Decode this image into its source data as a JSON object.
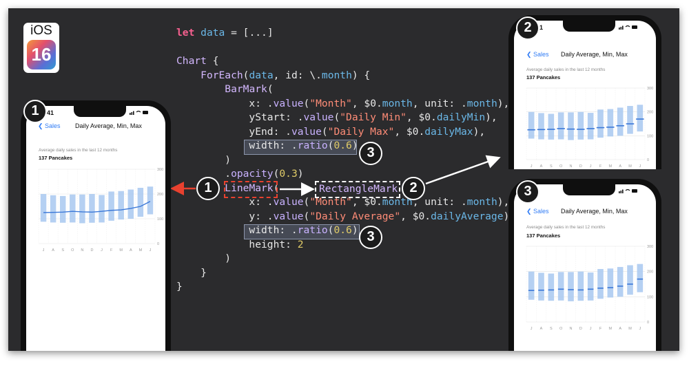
{
  "ios_badge": {
    "label": "iOS",
    "version": "16"
  },
  "code": {
    "lines": [
      [
        [
          "kw",
          "let "
        ],
        [
          "id",
          "data"
        ],
        [
          "pn",
          " = [...]"
        ]
      ],
      [],
      [
        [
          "tp",
          "Chart"
        ],
        [
          "pn",
          " {"
        ]
      ],
      [
        [
          "pn",
          "    "
        ],
        [
          "tp",
          "ForEach"
        ],
        [
          "pn",
          "("
        ],
        [
          "id",
          "data"
        ],
        [
          "pn",
          ", id: \\."
        ],
        [
          "id",
          "month"
        ],
        [
          "pn",
          ") {"
        ]
      ],
      [
        [
          "pn",
          "        "
        ],
        [
          "tp",
          "BarMark"
        ],
        [
          "pn",
          "("
        ]
      ],
      [
        [
          "pn",
          "            x: ."
        ],
        [
          "prop",
          "value"
        ],
        [
          "pn",
          "("
        ],
        [
          "str",
          "\"Month\""
        ],
        [
          "pn",
          ", $0."
        ],
        [
          "id",
          "month"
        ],
        [
          "pn",
          ", unit: ."
        ],
        [
          "id",
          "month"
        ],
        [
          "pn",
          "),"
        ]
      ],
      [
        [
          "pn",
          "            yStart: ."
        ],
        [
          "prop",
          "value"
        ],
        [
          "pn",
          "("
        ],
        [
          "str",
          "\"Daily Min\""
        ],
        [
          "pn",
          ", $0."
        ],
        [
          "id",
          "dailyMin"
        ],
        [
          "pn",
          "),"
        ]
      ],
      [
        [
          "pn",
          "            yEnd: ."
        ],
        [
          "prop",
          "value"
        ],
        [
          "pn",
          "("
        ],
        [
          "str",
          "\"Daily Max\""
        ],
        [
          "pn",
          ", $0."
        ],
        [
          "id",
          "dailyMax"
        ],
        [
          "pn",
          "),"
        ]
      ],
      [
        [
          "pn",
          "            width: ."
        ],
        [
          "prop",
          "ratio"
        ],
        [
          "pn",
          "("
        ],
        [
          "num",
          "0.6"
        ],
        [
          "pn",
          ")"
        ]
      ],
      [
        [
          "pn",
          "        )"
        ]
      ],
      [
        [
          "pn",
          "        ."
        ],
        [
          "prop",
          "opacity"
        ],
        [
          "pn",
          "("
        ],
        [
          "num",
          "0.3"
        ],
        [
          "pn",
          ")"
        ]
      ],
      [
        [
          "pn",
          "        "
        ],
        [
          "tp",
          "LineMark"
        ],
        [
          "pn",
          "("
        ]
      ],
      [
        [
          "pn",
          "            x: ."
        ],
        [
          "prop",
          "value"
        ],
        [
          "pn",
          "("
        ],
        [
          "str",
          "\"Month\""
        ],
        [
          "pn",
          ", $0."
        ],
        [
          "id",
          "month"
        ],
        [
          "pn",
          ", unit: ."
        ],
        [
          "id",
          "month"
        ],
        [
          "pn",
          "),"
        ]
      ],
      [
        [
          "pn",
          "            y: ."
        ],
        [
          "prop",
          "value"
        ],
        [
          "pn",
          "("
        ],
        [
          "str",
          "\"Daily Average\""
        ],
        [
          "pn",
          ", $0."
        ],
        [
          "id",
          "dailyAverage"
        ],
        [
          "pn",
          "),"
        ]
      ],
      [
        [
          "pn",
          "            width: ."
        ],
        [
          "prop",
          "ratio"
        ],
        [
          "pn",
          "("
        ],
        [
          "num",
          "0.6"
        ],
        [
          "pn",
          "),"
        ]
      ],
      [
        [
          "pn",
          "            height: "
        ],
        [
          "num",
          "2"
        ]
      ],
      [
        [
          "pn",
          "        )"
        ]
      ],
      [
        [
          "pn",
          "    }"
        ]
      ],
      [
        [
          "pn",
          "}"
        ]
      ]
    ],
    "replacement_label": "RectangleMark"
  },
  "colors": {
    "keyword": "#f7608f",
    "type": "#d4b8ff",
    "identifier": "#6bb8e8",
    "string": "#ff8c77",
    "number": "#e1cc68",
    "arrow_red": "#e8412f",
    "bar": "#a8c8f0",
    "line": "#3b78d8"
  },
  "callouts": {
    "one": "1",
    "two": "2",
    "three": "3"
  },
  "phones": [
    {
      "number": "1",
      "time": "41",
      "back_label": "Sales",
      "title": "Daily Average, Min, Max",
      "subtitle": "Average daily sales in the last 12 months",
      "headline": "137 Pancakes",
      "mark": "line"
    },
    {
      "number": "2",
      "time": "41",
      "back_label": "Sales",
      "title": "Daily Average, Min, Max",
      "subtitle": "Average daily sales in the last 12 months",
      "headline": "137 Pancakes",
      "mark": "rect-full"
    },
    {
      "number": "3",
      "time": "41",
      "back_label": "Sales",
      "title": "Daily Average, Min, Max",
      "subtitle": "Average daily sales in the last 12 months",
      "headline": "137 Pancakes",
      "mark": "rect-ratio"
    }
  ],
  "chart_data": {
    "type": "bar",
    "categories": [
      "J",
      "A",
      "S",
      "O",
      "N",
      "D",
      "J",
      "F",
      "M",
      "A",
      "M",
      "J"
    ],
    "y_ticks": [
      0,
      100,
      200,
      300
    ],
    "ylim": [
      0,
      300
    ],
    "series": [
      {
        "values_min": [
          88,
          85,
          84,
          85,
          82,
          84,
          85,
          92,
          97,
          100,
          108,
          118
        ]
      },
      {
        "values_max": [
          200,
          195,
          192,
          198,
          198,
          200,
          196,
          210,
          212,
          218,
          225,
          230
        ]
      },
      {
        "values_avg": [
          125,
          126,
          127,
          130,
          128,
          127,
          130,
          134,
          136,
          142,
          150,
          170
        ]
      }
    ]
  }
}
